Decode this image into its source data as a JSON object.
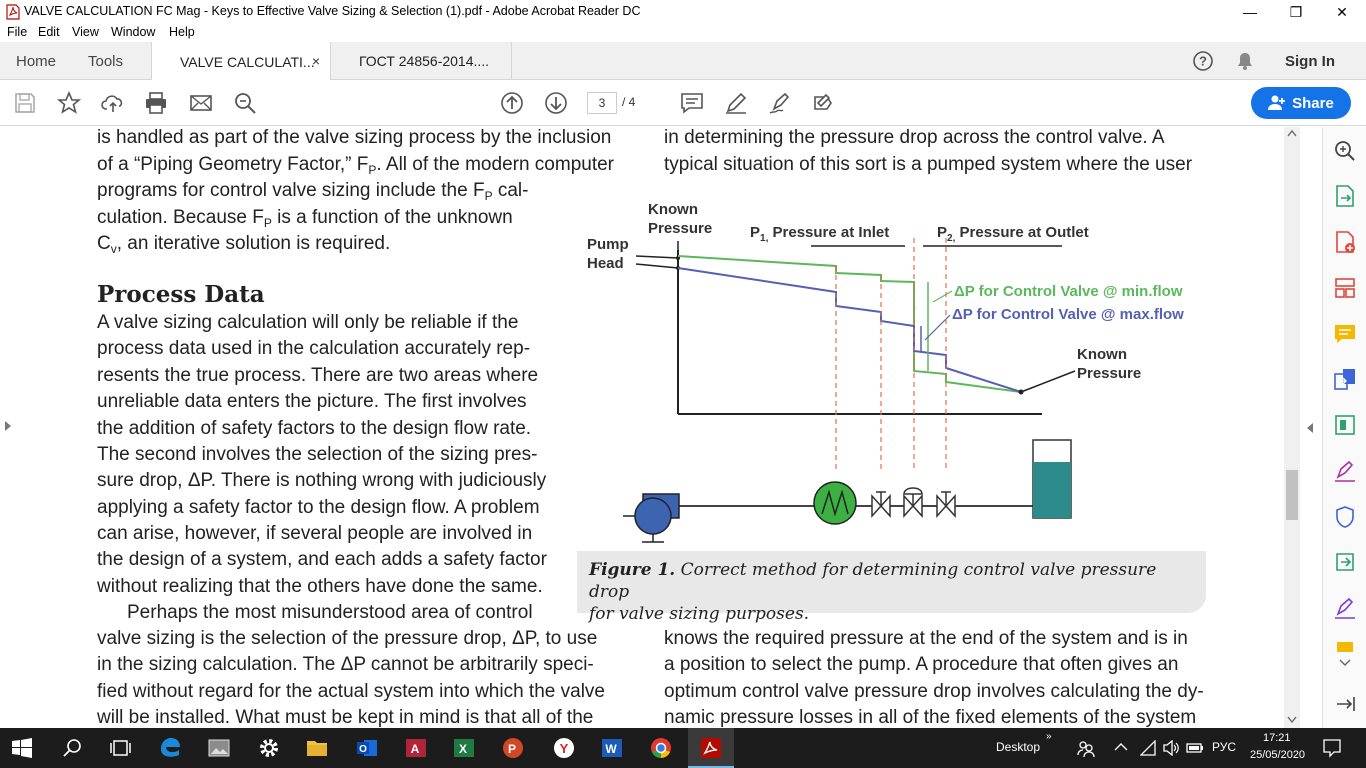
{
  "window": {
    "title": "VALVE CALCULATION FC Mag - Keys to Effective Valve Sizing & Selection (1).pdf - Adobe Acrobat Reader DC",
    "minimize": "—",
    "maximize": "❐",
    "close": "✕"
  },
  "menu": {
    "file": "File",
    "edit": "Edit",
    "view": "View",
    "window": "Window",
    "help": "Help"
  },
  "tabs": {
    "home": "Home",
    "tools": "Tools",
    "doc1": "VALVE CALCULATI...",
    "doc2": "ГОСТ 24856-2014....",
    "close": "×",
    "sign_in": "Sign In"
  },
  "toolbar": {
    "page_current": "3",
    "page_total": "/ 4",
    "share": "Share"
  },
  "document": {
    "left_col_top": [
      "is handled as part of the valve sizing process by the inclusion",
      "of a “Piping Geometry Factor,” F",
      "programs for control valve sizing include the F",
      "culation. Because F",
      "C"
    ],
    "l2_sub": "P",
    "l2_tail": ". All of the modern computer",
    "l3_sub": "P",
    "l3_tail": " cal-",
    "l4_sub": "P",
    "l4_tail": " is a function of the unknown",
    "l5_sub": "v",
    "l5_tail": ", an iterative solution is required.",
    "heading": "Process Data",
    "left_col_body": [
      "A valve sizing calculation will only be reliable if the",
      "process data used in the calculation accurately rep-",
      "resents the true process. There are two areas where",
      "unreliable data enters the picture. The first involves",
      "the addition of safety factors to the design flow rate.",
      "The second involves the selection of the sizing pres-",
      "sure drop, ΔP. There is nothing wrong with judiciously",
      "applying a safety factor to the design flow. A problem",
      "can arise, however, if several people are involved in",
      "the design of a system, and each adds a safety factor",
      "without realizing that the others have done the same.",
      "Perhaps the most misunderstood area of control",
      "valve sizing is the selection of the pressure drop, ΔP, to use",
      "in the sizing calculation. The ΔP cannot be arbitrarily speci-",
      "fied without regard for the actual system into which the valve",
      "will be installed. What must be kept in mind is that all of the"
    ],
    "right_col_top": [
      "in determining the pressure drop across the control valve. A",
      "typical situation of this sort is a pumped system where the user"
    ],
    "right_col_bottom": [
      "knows the required pressure at the end of the system and is in",
      "a position to select the pump. A procedure that often gives an",
      "optimum control valve pressure drop involves calculating the dy-",
      "namic pressure losses in all of the fixed elements of the system"
    ],
    "figure": {
      "known_pressure_top": [
        "Known",
        "Pressure"
      ],
      "pump_head": [
        "Pump",
        "Head"
      ],
      "p1_label": "P",
      "p1_sub": "1,",
      "p1_text": " Pressure at Inlet",
      "p2_label": "P",
      "p2_sub": "2,",
      "p2_text": " Pressure at Outlet",
      "dp_min": "ΔP for Control Valve @ min.flow",
      "dp_max": "ΔP for Control Valve @ max.flow",
      "known_pressure_right": [
        "Known",
        "Pressure"
      ],
      "caption_bold": "Figure 1.",
      "caption_text": " Correct method for determining control valve pressure drop",
      "caption_line2": "for valve sizing purposes.",
      "colors": {
        "min_flow": "#5cb85c",
        "max_flow": "#5560b5",
        "tank": "#2e8b8b",
        "pump": "#3d64b0",
        "inline_pump": "#3cb043"
      }
    }
  },
  "taskbar": {
    "desktop": "Desktop",
    "lang": "РУС",
    "time": "17:21",
    "date": "25/05/2020"
  }
}
